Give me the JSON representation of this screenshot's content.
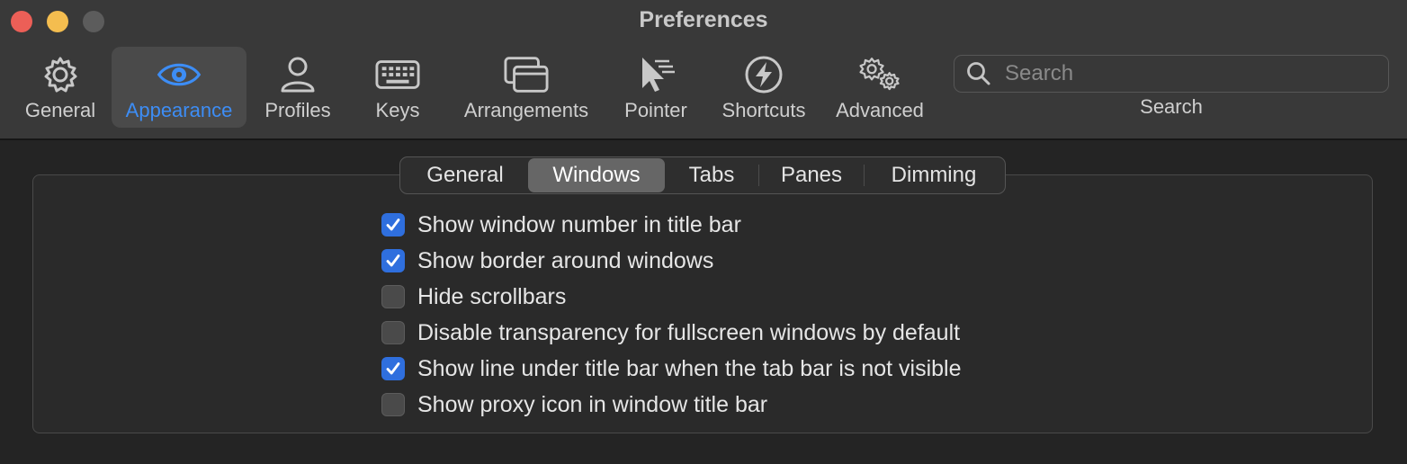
{
  "window": {
    "title": "Preferences"
  },
  "toolbar": {
    "items": [
      {
        "label": "General",
        "icon": "gear-icon"
      },
      {
        "label": "Appearance",
        "icon": "eye-icon",
        "active": true
      },
      {
        "label": "Profiles",
        "icon": "person-icon"
      },
      {
        "label": "Keys",
        "icon": "keyboard-icon"
      },
      {
        "label": "Arrangements",
        "icon": "windows-icon"
      },
      {
        "label": "Pointer",
        "icon": "pointer-icon"
      },
      {
        "label": "Shortcuts",
        "icon": "bolt-icon"
      },
      {
        "label": "Advanced",
        "icon": "gears-icon"
      }
    ],
    "search": {
      "placeholder": "Search",
      "value": "",
      "label": "Search"
    }
  },
  "tabs": [
    {
      "label": "General"
    },
    {
      "label": "Windows",
      "selected": true
    },
    {
      "label": "Tabs"
    },
    {
      "label": "Panes"
    },
    {
      "label": "Dimming"
    }
  ],
  "options": [
    {
      "label": "Show window number in title bar",
      "checked": true
    },
    {
      "label": "Show border around windows",
      "checked": true
    },
    {
      "label": "Hide scrollbars",
      "checked": false
    },
    {
      "label": "Disable transparency for fullscreen windows by default",
      "checked": false
    },
    {
      "label": "Show line under title bar when the tab bar is not visible",
      "checked": true
    },
    {
      "label": "Show proxy icon in window title bar",
      "checked": false
    }
  ],
  "colors": {
    "accent": "#3d8df5",
    "checkbox_on": "#2f6fde",
    "close": "#ec5f57",
    "minimize": "#f4bd4f"
  }
}
